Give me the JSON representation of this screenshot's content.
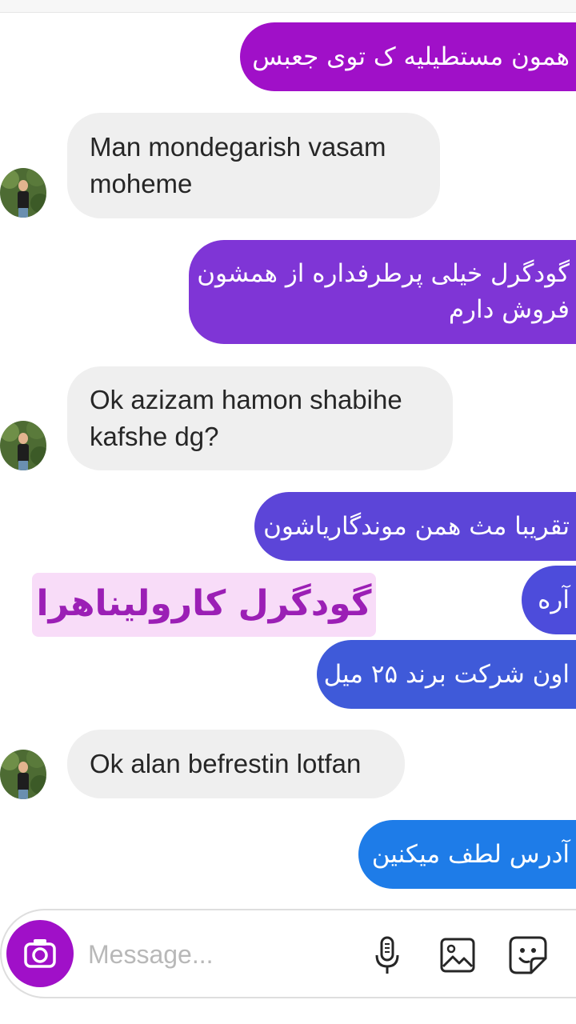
{
  "thread": {
    "messages": [
      {
        "from": "me",
        "text": "همون مستطیلیه ک توی جعبس"
      },
      {
        "from": "them",
        "lines": [
          "Man mondegarish vasam",
          "moheme"
        ]
      },
      {
        "from": "me",
        "lines": [
          "گودگرل خیلی پرطرفداره از همشون",
          "فروش دارم"
        ]
      },
      {
        "from": "them",
        "lines": [
          "Ok azizam hamon shabihe",
          "kafshe dg?"
        ]
      },
      {
        "from": "me",
        "text": "تقریبا مث همن موندگاریاشون"
      },
      {
        "from": "me",
        "text": "آره"
      },
      {
        "from": "me",
        "text": "اون شرکت برند ۲۵ میل"
      },
      {
        "from": "them",
        "text": "Ok alan befrestin lotfan"
      },
      {
        "from": "me",
        "text": "آدرس لطف میکنین"
      }
    ]
  },
  "watermark": {
    "text": "گودگرل کارولیناهرا"
  },
  "composer": {
    "placeholder": "Message...",
    "icons": [
      "camera-icon",
      "microphone-icon",
      "gallery-icon",
      "sticker-icon"
    ]
  },
  "colors": {
    "sent_top": "#a010c8",
    "sent_mid": "#7f35d6",
    "sent_low": "#5046d8",
    "sent_bottom": "#1e7ce8",
    "received_bg": "#efefef",
    "watermark_bg": "#f8dcf8",
    "watermark_text": "#9b1fb5"
  }
}
